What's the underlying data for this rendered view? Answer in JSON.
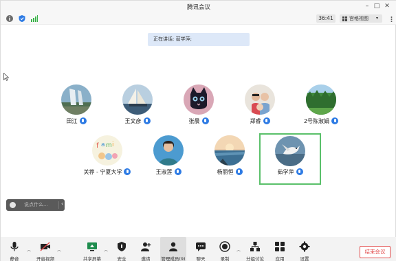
{
  "window": {
    "title": "腾讯会议"
  },
  "status": {
    "timer": "36:41",
    "view_label": "宫格视图"
  },
  "banner": {
    "speaking": "正在讲话: 茹学萍;"
  },
  "participants": [
    {
      "name": "田江",
      "muted": false
    },
    {
      "name": "王文彦",
      "muted": false
    },
    {
      "name": "张晨",
      "muted": false
    },
    {
      "name": "郑睿",
      "muted": false
    },
    {
      "name": "2号陈淑娟",
      "muted": false
    },
    {
      "name": "关荐 - 宁夏大学",
      "muted": false
    },
    {
      "name": "王淑莲",
      "muted": false
    },
    {
      "name": "杨丽恒",
      "muted": false
    },
    {
      "name": "茹学萍",
      "muted": false,
      "active": true
    }
  ],
  "chat": {
    "placeholder": "说点什么..."
  },
  "toolbar": {
    "mute": "静音",
    "video": "开启视频",
    "share": "共享屏幕",
    "security": "安全",
    "invite": "邀请",
    "members": "管理成员(9)",
    "chat": "聊天",
    "record": "录制",
    "breakout": "分组讨论",
    "apps": "应用",
    "settings": "设置",
    "end": "结束会议"
  },
  "colors": {
    "accent": "#2e7be4",
    "active_border": "#5ac06a",
    "end_red": "#e24b4b"
  }
}
